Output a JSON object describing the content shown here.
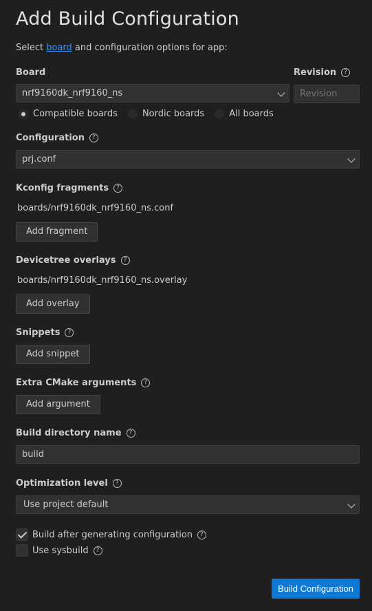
{
  "page": {
    "title": "Add Build Configuration",
    "subtitle_before": "Select ",
    "subtitle_link": "board",
    "subtitle_after": " and configuration options for app:"
  },
  "board": {
    "label": "Board",
    "value": "nrf9160dk_nrf9160_ns",
    "filters": [
      {
        "label": "Compatible boards",
        "selected": true
      },
      {
        "label": "Nordic boards",
        "selected": false
      },
      {
        "label": "All boards",
        "selected": false
      }
    ]
  },
  "revision": {
    "label": "Revision",
    "placeholder": "Revision"
  },
  "configuration": {
    "label": "Configuration",
    "value": "prj.conf"
  },
  "kconfig": {
    "label": "Kconfig fragments",
    "items": [
      "boards/nrf9160dk_nrf9160_ns.conf"
    ],
    "button": "Add fragment"
  },
  "devicetree": {
    "label": "Devicetree overlays",
    "items": [
      "boards/nrf9160dk_nrf9160_ns.overlay"
    ],
    "button": "Add overlay"
  },
  "snippets": {
    "label": "Snippets",
    "button": "Add snippet"
  },
  "cmake": {
    "label": "Extra CMake arguments",
    "button": "Add argument"
  },
  "build_dir": {
    "label": "Build directory name",
    "value": "build"
  },
  "optimization": {
    "label": "Optimization level",
    "value": "Use project default"
  },
  "options": {
    "build_after": {
      "label": "Build after generating configuration",
      "checked": true
    },
    "sysbuild": {
      "label": "Use sysbuild",
      "checked": false
    }
  },
  "actions": {
    "submit": "Build Configuration"
  },
  "icons": {
    "help": "question-circle-icon",
    "dropdown": "chevron-down-icon",
    "check": "checkmark-icon"
  },
  "colors": {
    "background": "#1f1f1f",
    "link": "#3794ff",
    "primary_button": "#0e78d4"
  }
}
